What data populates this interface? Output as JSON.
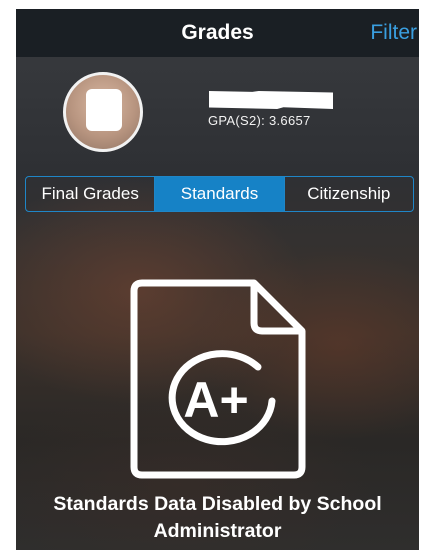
{
  "header": {
    "title": "Grades",
    "filter_label": "Filter"
  },
  "profile": {
    "gpa": "GPA(S2): 3.6657"
  },
  "tabs": [
    {
      "label": "Final Grades",
      "active": false
    },
    {
      "label": "Standards",
      "active": true
    },
    {
      "label": "Citizenship",
      "active": false
    }
  ],
  "empty_state": {
    "icon": "document-grade-icon",
    "grade_text": "A+",
    "message": "Standards Data Disabled by School Administrator"
  },
  "colors": {
    "header_bg": "#1a1f24",
    "accent": "#1682c6",
    "filter_link": "#3a9fe0"
  }
}
